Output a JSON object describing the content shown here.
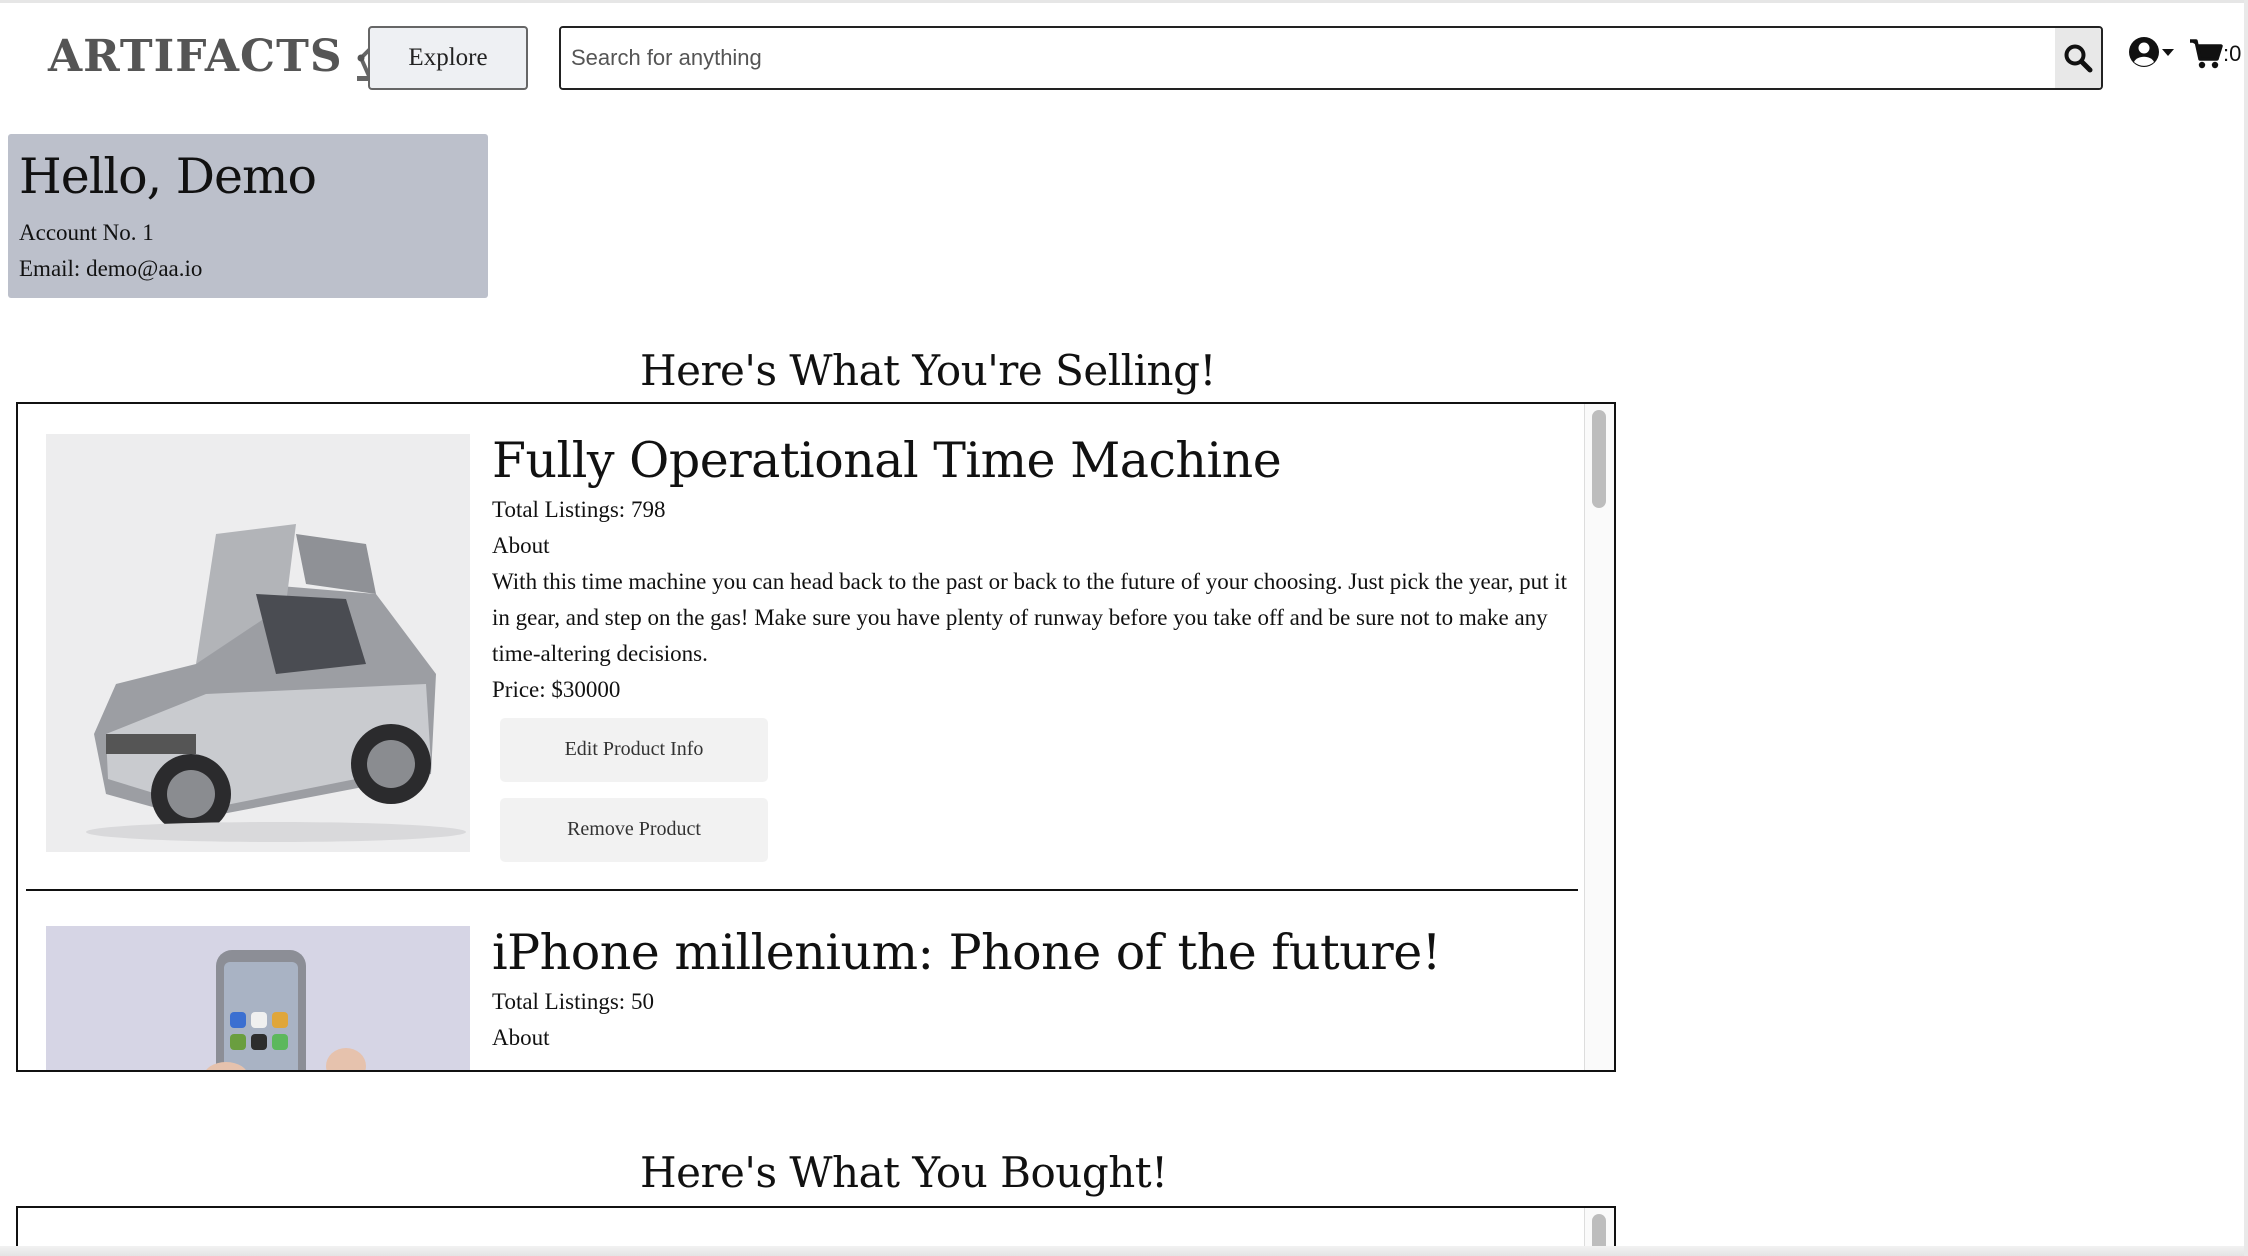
{
  "header": {
    "logo_text": "ARTIFACTS",
    "explore_label": "Explore",
    "search_placeholder": "Search for anything",
    "cart_count": ":0"
  },
  "profile": {
    "greeting": "Hello, Demo",
    "account": "Account No. 1",
    "email": "Email: demo@aa.io"
  },
  "selling": {
    "title": "Here's What You're Selling!",
    "items": [
      {
        "name": "Fully Operational Time Machine",
        "total_listings": "Total Listings: 798",
        "about_label": "About",
        "description": "With this time machine you can head back to the past or back to the future of your choosing. Just pick the year, put it in gear, and step on the gas! Make sure you have plenty of runway before you take off and be sure not to make any time-altering decisions.",
        "price": "Price: $30000",
        "edit_label": "Edit Product Info",
        "remove_label": "Remove Product"
      },
      {
        "name": "iPhone millenium: Phone of the future!",
        "total_listings": "Total Listings: 50",
        "about_label": "About"
      }
    ]
  },
  "bought": {
    "title": "Here's What You Bought!"
  },
  "colors": {
    "profile_bg": "#bcc0cb",
    "button_bg": "#f2f2f2"
  }
}
